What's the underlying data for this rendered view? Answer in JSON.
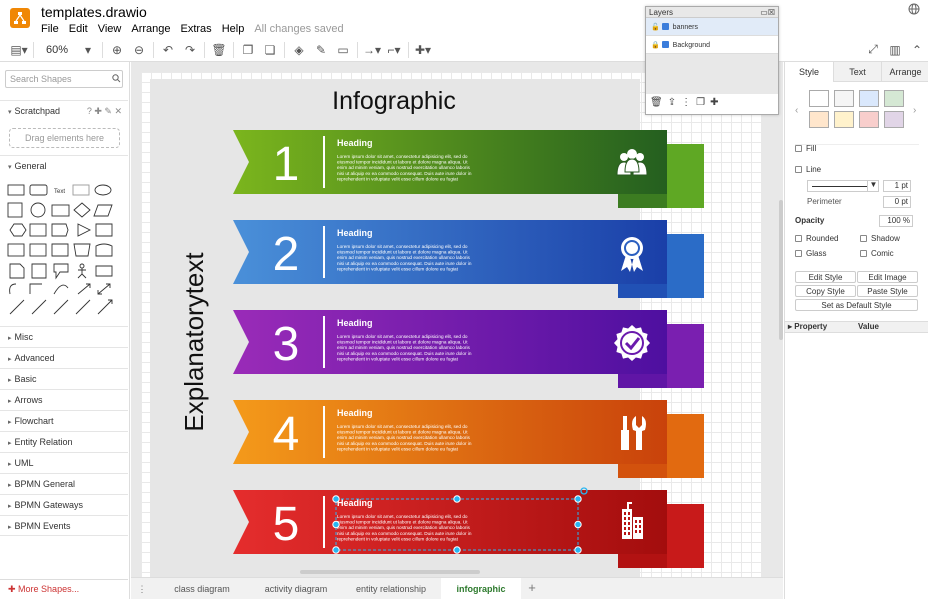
{
  "app": {
    "title": "templates.drawio",
    "menus": [
      "File",
      "Edit",
      "View",
      "Arrange",
      "Extras",
      "Help"
    ],
    "status": "All changes saved"
  },
  "toolbar": {
    "zoom": "60%"
  },
  "sidebar": {
    "search_placeholder": "Search Shapes",
    "scratchpad": "Scratchpad",
    "drag_hint": "Drag elements here",
    "general": "General",
    "sections": [
      "Misc",
      "Advanced",
      "Basic",
      "Arrows",
      "Flowchart",
      "Entity Relation",
      "UML",
      "BPMN General",
      "BPMN Gateways",
      "BPMN Events"
    ],
    "more_shapes": "More Shapes..."
  },
  "diagram": {
    "title": "Infographic",
    "side_text": "Explanatorytext",
    "banner_heading": "Heading",
    "banner_body": "Lorem ipsum dolor sit amet, consectetur adipisicing elit, sed do eiusmod tempor incididunt ut labore et dolore magna aliqua. Ut enim ad minim veniam, quis nostrud exercitation ullamco laboris nisi ut aliquip ex ea commodo consequat. Duis aute irure dolor in reprehenderit in voluptate velit esse cillum dolore eu fugiat nulla pariatur. Excepteur sint occaecat cupidatat non proident, sunt in culpa qui officia deserunt mollit anim id est laborum.",
    "banners": [
      {
        "number": "1",
        "heading": "Heading",
        "icon": "people-icon",
        "color_light": "#7bb51d",
        "color_dark": "#245f1f",
        "color_tail": "#5fa824"
      },
      {
        "number": "2",
        "heading": "Heading",
        "icon": "award-ribbon-icon",
        "color_light": "#4a90d9",
        "color_dark": "#1a3fa8",
        "color_tail": "#2b6cc7"
      },
      {
        "number": "3",
        "heading": "Heading",
        "icon": "badge-check-icon",
        "color_light": "#9a2bb8",
        "color_dark": "#4e0fa0",
        "color_tail": "#7a1fb0"
      },
      {
        "number": "4",
        "heading": "Heading",
        "icon": "tools-icon",
        "color_light": "#f49a1a",
        "color_dark": "#c9420b",
        "color_tail": "#e26a10"
      },
      {
        "number": "5",
        "heading": "Heading",
        "icon": "buildings-icon",
        "color_light": "#e52d2d",
        "color_dark": "#a30d0d",
        "color_tail": "#c81a1a"
      }
    ]
  },
  "tabs": [
    "class diagram",
    "activity diagram",
    "entity relationship",
    "infographic"
  ],
  "layers": {
    "title": "Layers",
    "items": [
      "banners",
      "Background"
    ]
  },
  "format": {
    "tabs": [
      "Style",
      "Text",
      "Arrange"
    ],
    "fill": "Fill",
    "line": "Line",
    "line_width": "1 pt",
    "perimeter": "Perimeter",
    "perimeter_value": "0 pt",
    "opacity": "Opacity",
    "opacity_value": "100 %",
    "rounded": "Rounded",
    "shadow": "Shadow",
    "glass": "Glass",
    "comic": "Comic",
    "edit_style": "Edit Style",
    "edit_image": "Edit Image",
    "copy_style": "Copy Style",
    "paste_style": "Paste Style",
    "set_default": "Set as Default Style",
    "property": "Property",
    "value": "Value",
    "swatches": [
      "#ffffff",
      "#f5f5f5",
      "#dae8fc",
      "#d5e8d4",
      "#ffe6cc",
      "#fff2cc",
      "#f8cecc",
      "#e1d5e7"
    ]
  }
}
